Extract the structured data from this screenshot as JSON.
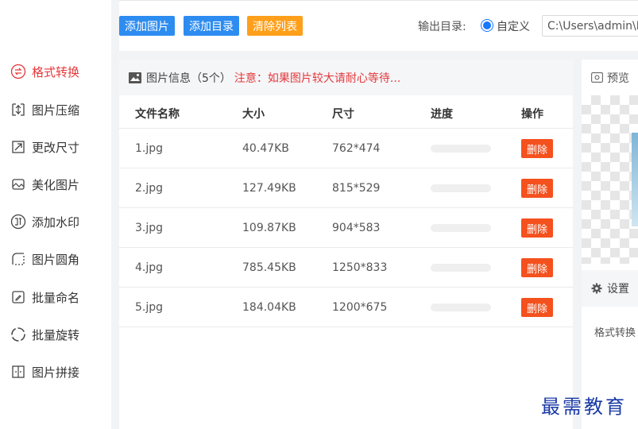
{
  "sidebar": {
    "items": [
      {
        "label": "格式转换",
        "icon": "swap-icon",
        "active": true
      },
      {
        "label": "图片压缩",
        "icon": "compress-icon",
        "active": false
      },
      {
        "label": "更改尺寸",
        "icon": "resize-icon",
        "active": false
      },
      {
        "label": "美化图片",
        "icon": "beautify-icon",
        "active": false
      },
      {
        "label": "添加水印",
        "icon": "watermark-icon",
        "active": false
      },
      {
        "label": "图片圆角",
        "icon": "rounded-corner-icon",
        "active": false
      },
      {
        "label": "批量命名",
        "icon": "rename-icon",
        "active": false
      },
      {
        "label": "批量旋转",
        "icon": "rotate-icon",
        "active": false
      },
      {
        "label": "图片拼接",
        "icon": "stitch-icon",
        "active": false
      }
    ]
  },
  "toolbar": {
    "add_image": "添加图片",
    "add_folder": "添加目录",
    "clear_list": "清除列表",
    "output_label": "输出目录:",
    "custom_option": "自定义",
    "output_path": "C:\\Users\\admin\\D"
  },
  "panel": {
    "title": "图片信息（5个）",
    "note": "注意：如果图片较大请耐心等待...",
    "columns": {
      "name": "文件名称",
      "size": "大小",
      "dims": "尺寸",
      "progress": "进度",
      "action": "操作"
    },
    "delete_label": "删除",
    "rows": [
      {
        "name": "1.jpg",
        "size": "40.47KB",
        "dims": "762*474",
        "progress": 0
      },
      {
        "name": "2.jpg",
        "size": "127.49KB",
        "dims": "815*529",
        "progress": 0
      },
      {
        "name": "3.jpg",
        "size": "109.87KB",
        "dims": "904*583",
        "progress": 0
      },
      {
        "name": "4.jpg",
        "size": "785.45KB",
        "dims": "1250*833",
        "progress": 0
      },
      {
        "name": "5.jpg",
        "size": "184.04KB",
        "dims": "1200*675",
        "progress": 0
      }
    ]
  },
  "preview": {
    "title": "预览"
  },
  "settings": {
    "title": "设置",
    "item": "格式转换"
  },
  "watermark": "最需教育",
  "colors": {
    "accent_red": "#e4393c",
    "button_blue": "#2d8cf0",
    "button_orange": "#ff9f1a",
    "delete_red": "#f4511e"
  }
}
